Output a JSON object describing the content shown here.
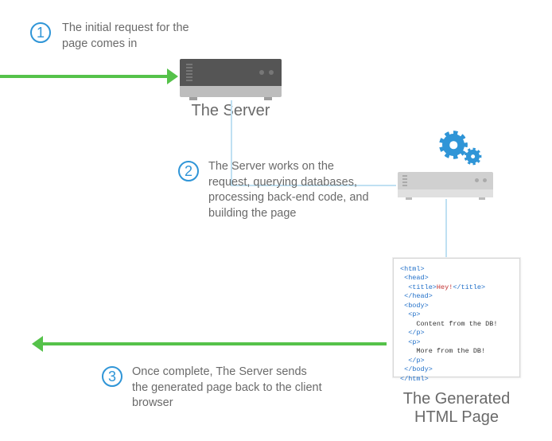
{
  "steps": {
    "s1": {
      "num": "1",
      "text": "The initial request for the page comes in"
    },
    "s2": {
      "num": "2",
      "text": "The Server works on the request, querying databases, processing back-end code, and building the page"
    },
    "s3": {
      "num": "3",
      "text": "Once complete, The Server sends the generated page back to the client browser"
    }
  },
  "captions": {
    "server": "The Server",
    "page": "The Generated HTML Page"
  },
  "html_snippet": {
    "title_text": "Hey!",
    "p1_text": "Content from the DB!",
    "p2_text": "More from the DB!",
    "tags": {
      "html_open": "<html>",
      "html_close": "</html>",
      "head_open": "<head>",
      "head_close": "</head>",
      "title_open": "<title>",
      "title_close": "</title>",
      "body_open": "<body>",
      "body_close": "</body>",
      "p_open": "<p>",
      "p_close": "</p>"
    }
  },
  "colors": {
    "accent_blue": "#2f95d7",
    "arrow_green": "#55c24a",
    "connector_blue": "#bfe0f2",
    "grey_text": "#6a6a6a"
  }
}
